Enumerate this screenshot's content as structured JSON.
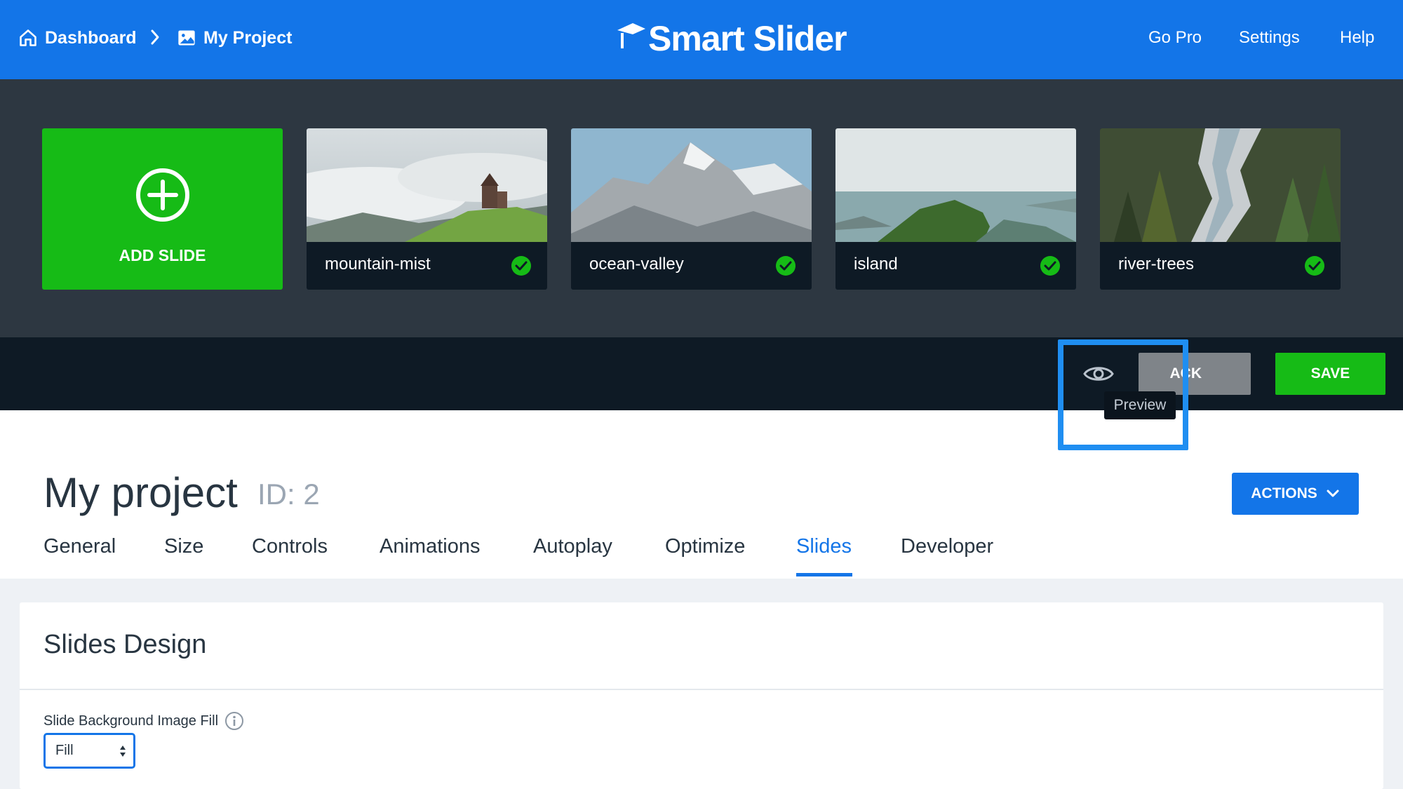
{
  "nav": {
    "dashboard_label": "Dashboard",
    "project_label": "My Project",
    "logo_text": "Smart Slider",
    "links": [
      "Go Pro",
      "Settings",
      "Help"
    ]
  },
  "slides": {
    "add_label": "ADD SLIDE",
    "items": [
      {
        "title": "mountain-mist",
        "published": true
      },
      {
        "title": "ocean-valley",
        "published": true
      },
      {
        "title": "island",
        "published": true
      },
      {
        "title": "river-trees",
        "published": true
      }
    ]
  },
  "toolbar": {
    "back_label": "ACK",
    "save_label": "SAVE",
    "preview_tooltip": "Preview"
  },
  "project": {
    "title": "My project",
    "id_label": "ID: 2",
    "actions_label": "ACTIONS"
  },
  "tabs": [
    {
      "label": "General"
    },
    {
      "label": "Size"
    },
    {
      "label": "Controls"
    },
    {
      "label": "Animations"
    },
    {
      "label": "Autoplay"
    },
    {
      "label": "Optimize"
    },
    {
      "label": "Slides",
      "active": true
    },
    {
      "label": "Developer"
    }
  ],
  "section": {
    "title": "Slides Design",
    "field_label": "Slide Background Image Fill",
    "field_value": "Fill"
  },
  "colors": {
    "brand_blue": "#1375e8",
    "green": "#16bb16",
    "dark": "#0e1a25"
  }
}
